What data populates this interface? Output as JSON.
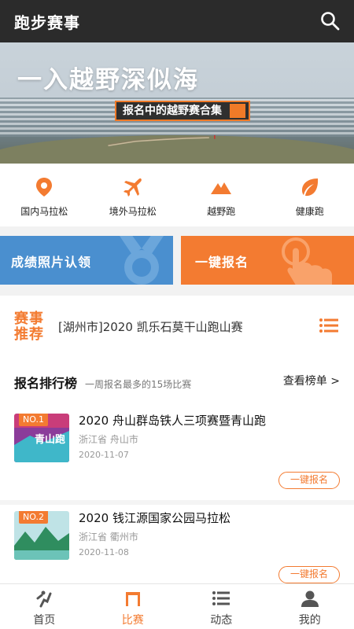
{
  "appbar": {
    "title": "跑步赛事"
  },
  "banner": {
    "headline": "一入越野深似海",
    "tag": "报名中的越野赛合集"
  },
  "categories": [
    {
      "label": "国内马拉松",
      "icon": "location-pin-icon"
    },
    {
      "label": "境外马拉松",
      "icon": "airplane-icon"
    },
    {
      "label": "越野跑",
      "icon": "mountain-icon"
    },
    {
      "label": "健康跑",
      "icon": "leaf-icon"
    }
  ],
  "promos": {
    "left": "成绩照片认领",
    "right": "一键报名"
  },
  "recommend": {
    "badge_line1": "赛事",
    "badge_line2": "推荐",
    "text": "[湖州市]2020 凯乐石莫干山跑山赛"
  },
  "ranking": {
    "title": "报名排行榜",
    "subtitle": "一周报名最多的15场比赛",
    "more": "查看榜单 >",
    "items": [
      {
        "rank": "NO.1",
        "name": "2020 舟山群岛铁人三项赛暨青山跑",
        "location": "浙江省  舟山市",
        "date": "2020-11-07",
        "button": "一键报名",
        "thumb_text": "青山跑"
      },
      {
        "rank": "NO.2",
        "name": "2020 钱江源国家公园马拉松",
        "location": "浙江省  衢州市",
        "date": "2020-11-08",
        "button": "一键报名",
        "thumb_text": ""
      }
    ]
  },
  "tabs": [
    {
      "label": "首页",
      "icon": "run-icon",
      "active": false
    },
    {
      "label": "比赛",
      "icon": "race-gate-icon",
      "active": true
    },
    {
      "label": "动态",
      "icon": "list-icon",
      "active": false
    },
    {
      "label": "我的",
      "icon": "person-icon",
      "active": false
    }
  ],
  "colors": {
    "accent": "#f37b31",
    "blue": "#4a8fcf",
    "appbar": "#2b2b2b"
  }
}
